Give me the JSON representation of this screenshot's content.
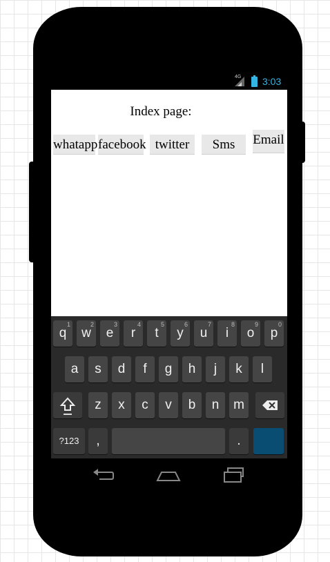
{
  "status_bar": {
    "network": "4G",
    "time": "3:03"
  },
  "page": {
    "title": "Index page:"
  },
  "buttons": [
    "whatapp",
    "facebook",
    "twitter",
    "Sms",
    "Email"
  ],
  "keyboard": {
    "row1": [
      {
        "key": "q",
        "hint": "1"
      },
      {
        "key": "w",
        "hint": "2"
      },
      {
        "key": "e",
        "hint": "3"
      },
      {
        "key": "r",
        "hint": "4"
      },
      {
        "key": "t",
        "hint": "5"
      },
      {
        "key": "y",
        "hint": "6"
      },
      {
        "key": "u",
        "hint": "7"
      },
      {
        "key": "i",
        "hint": "8"
      },
      {
        "key": "o",
        "hint": "9"
      },
      {
        "key": "p",
        "hint": "0"
      }
    ],
    "row2": [
      "a",
      "s",
      "d",
      "f",
      "g",
      "h",
      "j",
      "k",
      "l"
    ],
    "row3": [
      "z",
      "x",
      "c",
      "v",
      "b",
      "n",
      "m"
    ],
    "symbols_label": "?123",
    "comma_label": ",",
    "period_label": "."
  },
  "icons": {
    "signal": "signal-icon",
    "battery": "battery-icon",
    "shift": "shift-icon",
    "backspace": "backspace-icon",
    "back": "back-icon",
    "home": "home-icon",
    "recents": "recents-icon"
  },
  "colors": {
    "status_accent": "#33b5e5",
    "enter_key": "#0a4d73",
    "key": "#454545"
  }
}
